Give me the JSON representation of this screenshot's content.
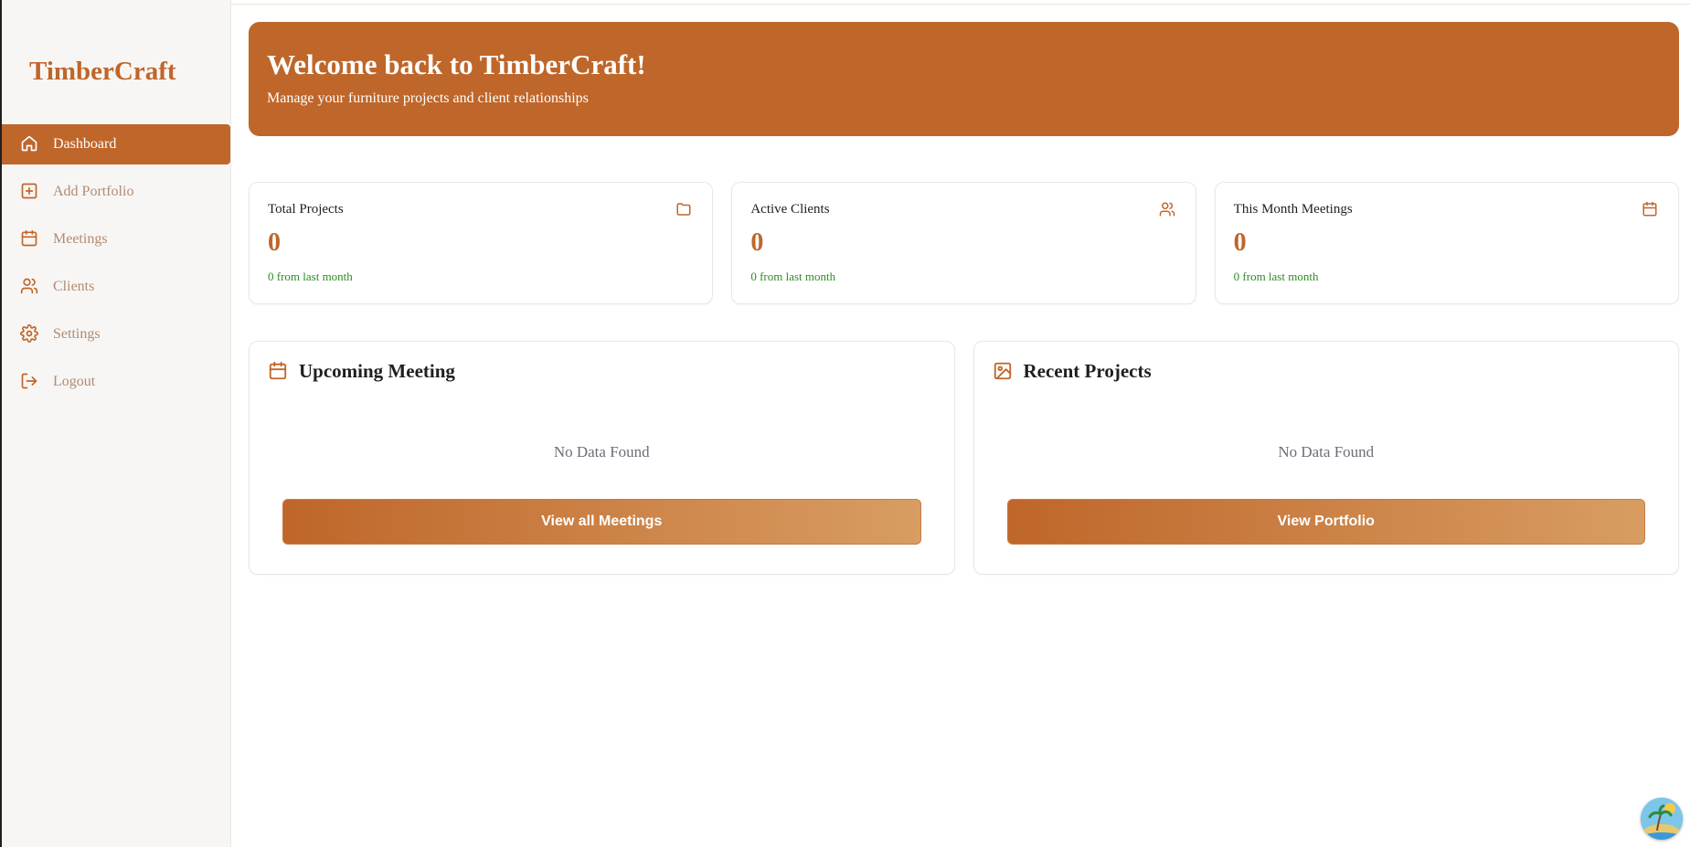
{
  "brand": {
    "name": "TimberCraft",
    "accent": "#bf662a"
  },
  "sidebar": {
    "items": [
      {
        "label": "Dashboard",
        "icon": "home-icon",
        "active": true
      },
      {
        "label": "Add Portfolio",
        "icon": "plus-square-icon",
        "active": false
      },
      {
        "label": "Meetings",
        "icon": "calendar-icon",
        "active": false
      },
      {
        "label": "Clients",
        "icon": "users-icon",
        "active": false
      },
      {
        "label": "Settings",
        "icon": "gear-icon",
        "active": false
      },
      {
        "label": "Logout",
        "icon": "logout-icon",
        "active": false
      }
    ]
  },
  "hero": {
    "title": "Welcome back to TimberCraft!",
    "subtitle": "Manage your furniture projects and client relationships"
  },
  "stats": [
    {
      "label": "Total Projects",
      "value": "0",
      "delta": "0 from last month",
      "icon": "folder-icon"
    },
    {
      "label": "Active Clients",
      "value": "0",
      "delta": "0 from last month",
      "icon": "users-icon"
    },
    {
      "label": "This Month Meetings",
      "value": "0",
      "delta": "0 from last month",
      "icon": "calendar-icon"
    }
  ],
  "panels": [
    {
      "title": "Upcoming Meeting",
      "icon": "calendar-icon",
      "empty_text": "No Data Found",
      "button_label": "View all Meetings"
    },
    {
      "title": "Recent Projects",
      "icon": "image-icon",
      "empty_text": "No Data Found",
      "button_label": "View Portfolio"
    }
  ],
  "colors": {
    "delta_green": "#2f8a24",
    "muted_nav": "#b08b73"
  }
}
